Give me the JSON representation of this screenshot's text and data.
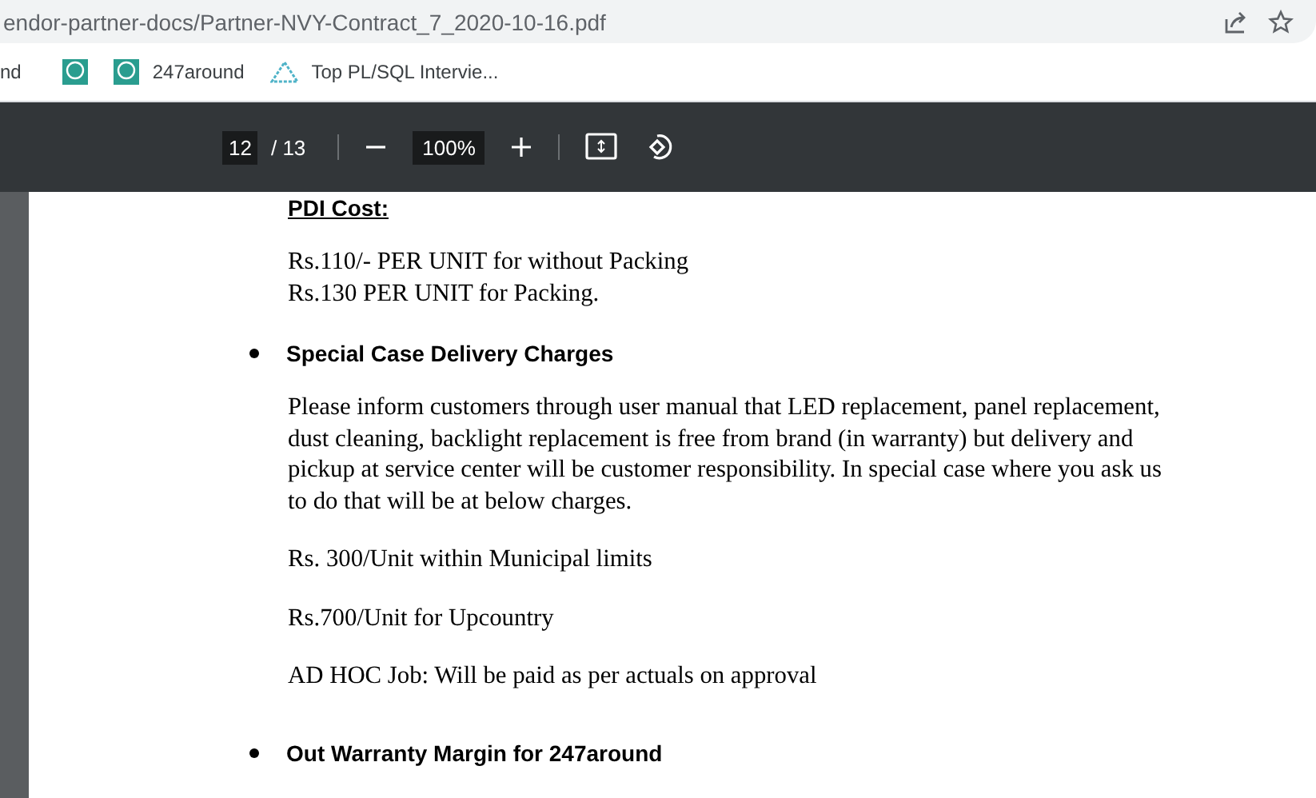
{
  "address_bar": {
    "url": "endor-partner-docs/Partner-NVY-Contract_7_2020-10-16.pdf"
  },
  "bookmarks": [
    {
      "kind": "text",
      "label": "nd"
    },
    {
      "kind": "logo"
    },
    {
      "kind": "logo",
      "label": "247around"
    },
    {
      "kind": "chart",
      "label": "Top PL/SQL Intervie..."
    }
  ],
  "pdf_toolbar": {
    "page": "12",
    "total": "/ 13",
    "zoom": "100%"
  },
  "document": [
    {
      "kind": "heading",
      "text": "PDI Cost:"
    },
    {
      "kind": "lines",
      "lines": [
        "Rs.110/- PER UNIT for without Packing",
        "Rs.130 PER UNIT for Packing."
      ]
    },
    {
      "kind": "bullet",
      "text": "Special Case Delivery Charges"
    },
    {
      "kind": "para",
      "lines": [
        "Please inform customers through user manual that LED replacement, panel replacement,",
        "dust cleaning, backlight replacement is free from brand (in warranty) but delivery and",
        "pickup at service center will be customer responsibility. In special case where you ask us",
        "to do that will be at below charges."
      ]
    },
    {
      "kind": "para",
      "lines": [
        "Rs. 300/Unit within Municipal limits"
      ]
    },
    {
      "kind": "para",
      "lines": [
        "Rs.700/Unit for Upcountry"
      ]
    },
    {
      "kind": "para",
      "lines": [
        "AD HOC Job: Will be paid as per actuals on approval"
      ]
    },
    {
      "kind": "bullet",
      "text": "Out Warranty Margin for 247around"
    }
  ]
}
